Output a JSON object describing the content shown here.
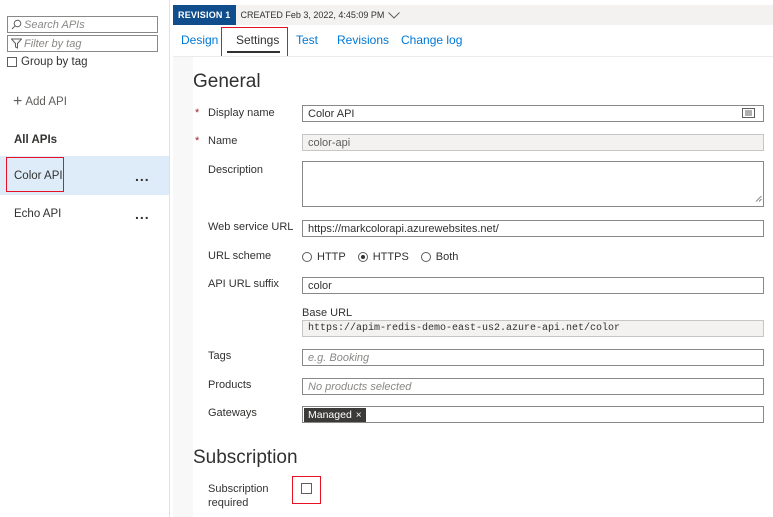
{
  "sidebar": {
    "search_placeholder": "Search APIs",
    "filter_placeholder": "Filter by tag",
    "group_by_tag_label": "Group by tag",
    "add_api_label": "Add API",
    "section_title": "All APIs",
    "apis": [
      {
        "name": "Color API",
        "menu": "...",
        "selected": true
      },
      {
        "name": "Echo API",
        "menu": "...",
        "selected": false
      }
    ]
  },
  "revision": {
    "badge": "REVISION 1",
    "created": "CREATED Feb 3, 2022, 4:45:09 PM"
  },
  "tabs": [
    {
      "label": "Design",
      "active": false
    },
    {
      "label": "Settings",
      "active": true
    },
    {
      "label": "Test",
      "active": false
    },
    {
      "label": "Revisions",
      "active": false
    },
    {
      "label": "Change log",
      "active": false
    }
  ],
  "general": {
    "heading": "General",
    "display_name_label": "Display name",
    "display_name_value": "Color API",
    "name_label": "Name",
    "name_value": "color-api",
    "description_label": "Description",
    "description_value": "",
    "web_service_url_label": "Web service URL",
    "web_service_url_value": "https://markcolorapi.azurewebsites.net/",
    "url_scheme_label": "URL scheme",
    "url_scheme_options": [
      "HTTP",
      "HTTPS",
      "Both"
    ],
    "url_scheme_selected": "HTTPS",
    "api_url_suffix_label": "API URL suffix",
    "api_url_suffix_value": "color",
    "base_url_label": "Base URL",
    "base_url_value": "https://apim-redis-demo-east-us2.azure-api.net/color",
    "tags_label": "Tags",
    "tags_placeholder": "e.g. Booking",
    "products_label": "Products",
    "products_placeholder": "No products selected",
    "gateways_label": "Gateways",
    "gateway_chip": "Managed",
    "gateway_chip_remove": "×"
  },
  "subscription": {
    "heading": "Subscription",
    "required_label_line1": "Subscription",
    "required_label_line2": "required",
    "required_checked": false
  },
  "required_marker": "*",
  "colors": {
    "accent": "#0078d4",
    "revision_badge": "#0f4d8c",
    "selected_row": "#deecf9",
    "highlight_box": "#e81123"
  }
}
